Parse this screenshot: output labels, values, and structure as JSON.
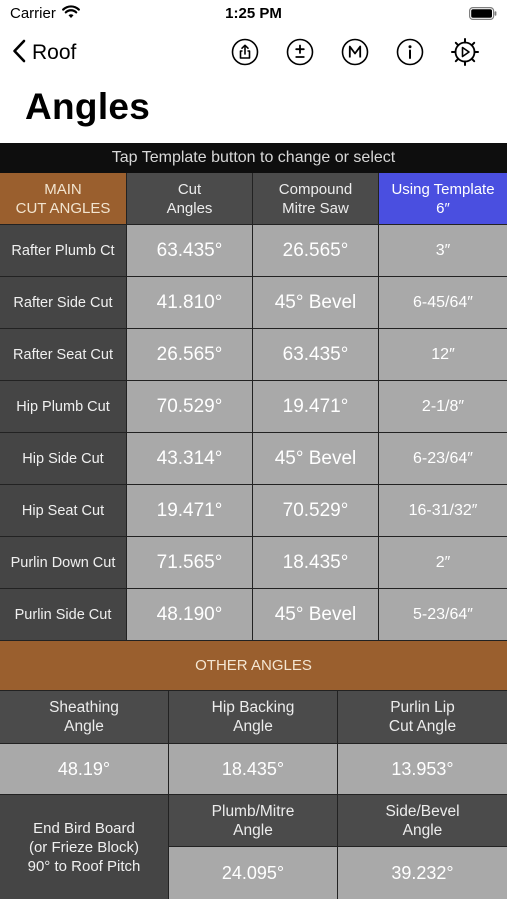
{
  "status_bar": {
    "carrier": "Carrier",
    "time": "1:25 PM"
  },
  "nav": {
    "back_label": "Roof"
  },
  "page": {
    "title": "Angles"
  },
  "banner": "Tap Template button to change or select",
  "table": {
    "headers": [
      "MAIN\nCUT ANGLES",
      "Cut\nAngles",
      "Compound\nMitre Saw",
      "Using Template\n6″"
    ],
    "rows": [
      {
        "label": "Rafter Plumb Ct",
        "cut": "63.435°",
        "saw": "26.565°",
        "tpl": "3″"
      },
      {
        "label": "Rafter Side Cut",
        "cut": "41.810°",
        "saw": "45° Bevel",
        "tpl": "6-45/64″"
      },
      {
        "label": "Rafter Seat Cut",
        "cut": "26.565°",
        "saw": "63.435°",
        "tpl": "12″"
      },
      {
        "label": "Hip Plumb Cut",
        "cut": "70.529°",
        "saw": "19.471°",
        "tpl": "2-1/8″"
      },
      {
        "label": "Hip Side Cut",
        "cut": "43.314°",
        "saw": "45° Bevel",
        "tpl": "6-23/64″"
      },
      {
        "label": "Hip Seat Cut",
        "cut": "19.471°",
        "saw": "70.529°",
        "tpl": "16-31/32″"
      },
      {
        "label": "Purlin Down Cut",
        "cut": "71.565°",
        "saw": "18.435°",
        "tpl": "2″"
      },
      {
        "label": "Purlin Side Cut",
        "cut": "48.190°",
        "saw": "45° Bevel",
        "tpl": "5-23/64″"
      }
    ]
  },
  "other": {
    "title": "OTHER ANGLES",
    "headers": [
      "Sheathing\nAngle",
      "Hip Backing\nAngle",
      "Purlin Lip\nCut Angle"
    ],
    "values": [
      "48.19°",
      "18.435°",
      "13.953°"
    ],
    "bird_label": "End Bird Board\n(or Frieze Block)\n90° to Roof Pitch",
    "bird_headers": [
      "Plumb/Mitre\nAngle",
      "Side/Bevel\nAngle"
    ],
    "bird_values": [
      "24.095°",
      "39.232°"
    ]
  },
  "colors": {
    "accent_brown": "#9a5f2e",
    "template_blue": "#4a4fe0",
    "label_dark": "#454545",
    "value_gray": "#a9a9a9"
  },
  "icons": [
    "share-icon",
    "plus-minus-icon",
    "memory-icon",
    "info-icon",
    "settings-icon"
  ]
}
